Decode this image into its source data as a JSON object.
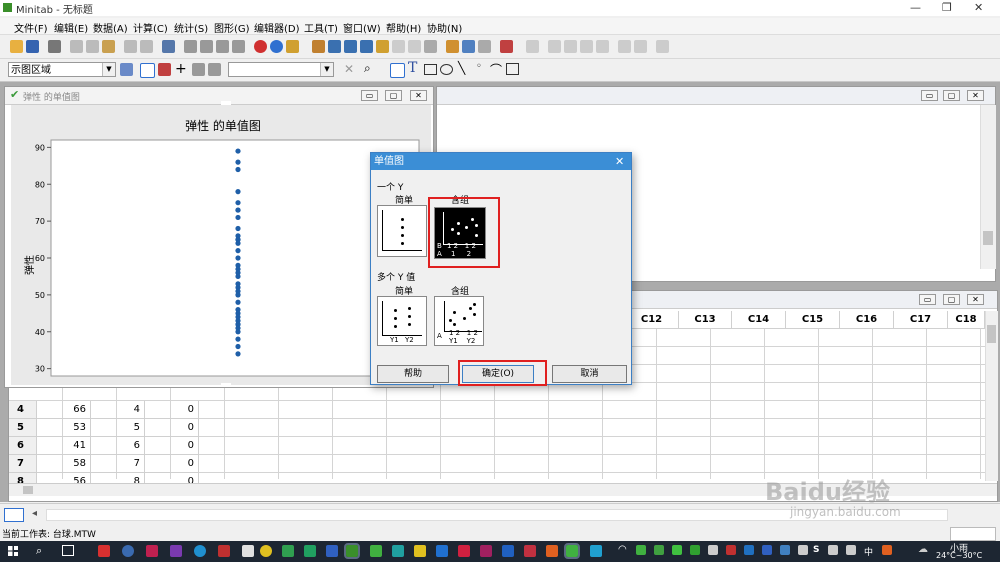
{
  "window": {
    "title": "Minitab - 无标题",
    "controls": [
      "—",
      "❐",
      "✕"
    ]
  },
  "menu": [
    "文件(F)",
    "编辑(E)",
    "数据(A)",
    "计算(C)",
    "统计(S)",
    "图形(G)",
    "编辑器(D)",
    "工具(T)",
    "窗口(W)",
    "帮助(H)",
    "协助(N)"
  ],
  "toolbar": {
    "region_combo": "示图区域",
    "font_combo": ""
  },
  "graph_window": {
    "title": "弹性 的单值图",
    "chart_title": "弹性 的单值图",
    "buttons": [
      "▭",
      "▢",
      "✕"
    ]
  },
  "chart_data": {
    "type": "scatter",
    "title": "弹性 的单值图",
    "ylabel": "弹性",
    "xlabel": "",
    "ylim": [
      28,
      92
    ],
    "yticks": [
      30,
      40,
      50,
      60,
      70,
      80,
      90
    ],
    "values": [
      89,
      86,
      84,
      78,
      75,
      73,
      73,
      71,
      68,
      66,
      65,
      65,
      64,
      62,
      60,
      58,
      57,
      56,
      55,
      53,
      52,
      51,
      50,
      50,
      48,
      46,
      45,
      44,
      43,
      42,
      42,
      41,
      40,
      38,
      36,
      34
    ]
  },
  "session_window": {
    "buttons": [
      "▭",
      "▢",
      "✕"
    ]
  },
  "worksheet": {
    "buttons": [
      "▭",
      "▢",
      "✕"
    ],
    "columns": [
      "C12",
      "C13",
      "C14",
      "C15",
      "C16",
      "C17",
      "C18"
    ],
    "rows": [
      {
        "n": "4",
        "c1": "66",
        "c2": "4",
        "c3": "0"
      },
      {
        "n": "5",
        "c1": "53",
        "c2": "5",
        "c3": "0"
      },
      {
        "n": "6",
        "c1": "41",
        "c2": "6",
        "c3": "0"
      },
      {
        "n": "7",
        "c1": "58",
        "c2": "7",
        "c3": "0"
      },
      {
        "n": "8",
        "c1": "56",
        "c2": "8",
        "c3": "0"
      }
    ]
  },
  "dialog": {
    "title": "单值图",
    "close": "✕",
    "section_one_y": "一个 Y",
    "simple_label": "简单",
    "with_groups_label": "含组",
    "section_multi_y": "多个 Y 值",
    "multi_simple_label": "简单",
    "multi_groups_label": "含组",
    "help_button": "帮助",
    "ok_button": "确定(O)",
    "cancel_button": "取消",
    "thumb_text": {
      "group_b": "B",
      "group_a": "A",
      "b_ticks": "1 2   1 2",
      "a_ticks": "1     2",
      "y1": "Y1",
      "y2": "Y2",
      "multi_a": "A",
      "multi_ticks": "1 2   1 2",
      "multi_ys": "Y1    Y2"
    }
  },
  "status": {
    "text": "当前工作表: 台球.MTW"
  },
  "taskbar": {
    "weather": "24°C~30°C",
    "ime": "中",
    "s_label": "S",
    "time_label": "小雨"
  },
  "watermark": {
    "brand": "Baidu经验",
    "url": "jingyan.baidu.com"
  }
}
